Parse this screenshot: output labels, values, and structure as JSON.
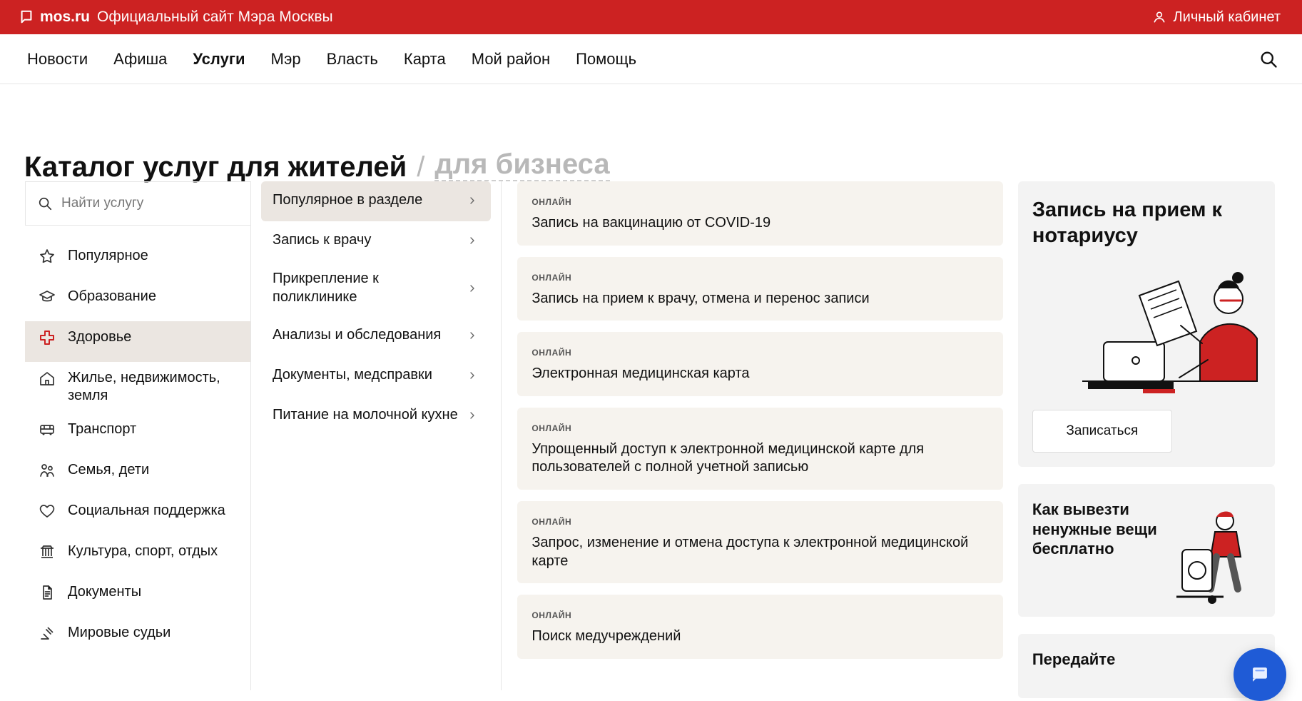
{
  "header": {
    "brand": "mos.ru",
    "tagline": "Официальный сайт Мэра Москвы",
    "cabinet": "Личный кабинет",
    "colors": {
      "topbar": "#cc2222"
    }
  },
  "nav": {
    "items": [
      {
        "label": "Новости",
        "active": false
      },
      {
        "label": "Афиша",
        "active": false
      },
      {
        "label": "Услуги",
        "active": true
      },
      {
        "label": "Мэр",
        "active": false
      },
      {
        "label": "Власть",
        "active": false
      },
      {
        "label": "Карта",
        "active": false
      },
      {
        "label": "Мой район",
        "active": false
      },
      {
        "label": "Помощь",
        "active": false
      }
    ]
  },
  "page": {
    "title": "Каталог услуг для жителей",
    "slash": "/",
    "business_link": "для бизнеса"
  },
  "search": {
    "placeholder": "Найти услугу"
  },
  "categories": [
    {
      "label": "Популярное",
      "icon": "star-icon",
      "active": false
    },
    {
      "label": "Образование",
      "icon": "graduation-cap-icon",
      "active": false
    },
    {
      "label": "Здоровье",
      "icon": "medical-cross-icon",
      "active": true
    },
    {
      "label": "Жилье, недвижимость, земля",
      "icon": "home-icon",
      "active": false
    },
    {
      "label": "Транспорт",
      "icon": "bus-icon",
      "active": false
    },
    {
      "label": "Семья, дети",
      "icon": "family-icon",
      "active": false
    },
    {
      "label": "Социальная поддержка",
      "icon": "heart-icon",
      "active": false
    },
    {
      "label": "Культура, спорт, отдых",
      "icon": "building-icon",
      "active": false
    },
    {
      "label": "Документы",
      "icon": "document-icon",
      "active": false
    },
    {
      "label": "Мировые судьи",
      "icon": "gavel-icon",
      "active": false
    }
  ],
  "subcategories": [
    {
      "label": "Популярное в разделе",
      "active": true
    },
    {
      "label": "Запись к врачу",
      "active": false
    },
    {
      "label": "Прикрепление к поликлинике",
      "active": false
    },
    {
      "label": "Анализы и обследования",
      "active": false
    },
    {
      "label": "Документы, медсправки",
      "active": false
    },
    {
      "label": "Питание на молочной кухне",
      "active": false
    }
  ],
  "services": [
    {
      "badge": "ОНЛАЙН",
      "name": "Запись на вакцинацию от COVID-19"
    },
    {
      "badge": "ОНЛАЙН",
      "name": "Запись на прием к врачу, отмена и перенос записи"
    },
    {
      "badge": "ОНЛАЙН",
      "name": "Электронная медицинская карта"
    },
    {
      "badge": "ОНЛАЙН",
      "name": "Упрощенный доступ к электронной медицинской карте для пользователей с полной учетной записью"
    },
    {
      "badge": "ОНЛАЙН",
      "name": "Запрос, изменение и отмена доступа к электронной медицинской карте"
    },
    {
      "badge": "ОНЛАЙН",
      "name": "Поиск медучреждений"
    }
  ],
  "promos": {
    "notary": {
      "title": "Запись на прием к нотариусу",
      "button": "Записаться"
    },
    "export": {
      "title": "Как вывезти ненужные вещи бесплатно"
    },
    "handover": {
      "title": "Передайте"
    }
  }
}
